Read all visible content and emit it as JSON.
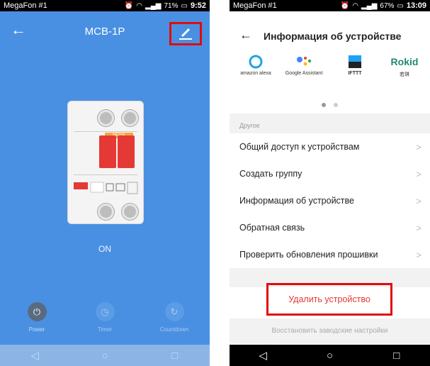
{
  "left": {
    "status": {
      "carrier": "MegaFon #1",
      "battery": "71%",
      "time": "9:52"
    },
    "title": "MCB-1P",
    "device_brand": "MOYK",
    "state": "ON",
    "controls": [
      {
        "label": "Power",
        "glyph": "⏻",
        "active": true
      },
      {
        "label": "Timer",
        "glyph": "◷",
        "active": false
      },
      {
        "label": "Countdown",
        "glyph": "↻",
        "active": false
      }
    ],
    "nav": {
      "back": "◁",
      "home": "○",
      "recent": "□"
    },
    "colors": {
      "background": "#4a90e2",
      "highlight": "#e10b0b"
    }
  },
  "right": {
    "status": {
      "carrier": "MegaFon #1",
      "battery": "67%",
      "time": "13:09"
    },
    "title": "Информация об устройстве",
    "integrations": [
      {
        "name": "amazon alexa",
        "icon": "alexa-icon"
      },
      {
        "name": "Google Assistant",
        "icon": "google-assistant-icon"
      },
      {
        "name": "IFTTT",
        "icon": "ifttt-icon"
      },
      {
        "name": "若琪",
        "icon": "rokid-icon",
        "logo_text": "Rokid"
      }
    ],
    "section_label": "Другое",
    "menu": [
      "Общий доступ к устройствам",
      "Создать группу",
      "Информация об устройстве",
      "Обратная связь",
      "Проверить обновления прошивки"
    ],
    "delete_label": "Удалить устройство",
    "reset_label": "Восстановить заводские настройки",
    "nav": {
      "back": "◁",
      "home": "○",
      "recent": "□"
    }
  }
}
